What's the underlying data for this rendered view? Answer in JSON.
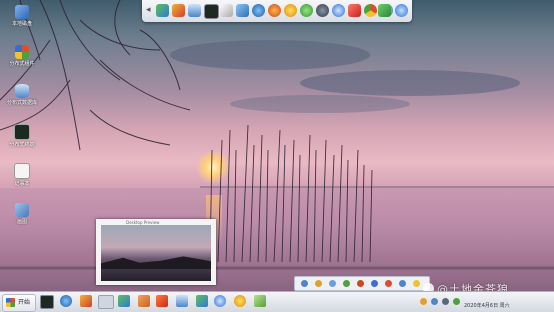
{
  "desktop": {
    "icons": [
      {
        "label": "本地磁盘",
        "icon": "computer-icon"
      },
      {
        "label": "分布式组件",
        "icon": "components-icon"
      },
      {
        "label": "分布式数据库",
        "icon": "database-icon"
      },
      {
        "label": "分布式终端",
        "icon": "terminal-icon"
      },
      {
        "label": "记事本",
        "icon": "notepad-icon"
      },
      {
        "label": "画图",
        "icon": "paint-icon"
      }
    ]
  },
  "quickbar": {
    "icons": [
      "users-icon",
      "tools-icon",
      "database-icon",
      "terminal-icon",
      "pen-icon",
      "network-icon",
      "globe-icon",
      "firefox-icon",
      "sun-icon",
      "green-orb-icon",
      "gear-icon",
      "safari-icon",
      "red-app-icon",
      "chrome-icon",
      "blue-globe-icon",
      "monitor-icon",
      "power-icon"
    ]
  },
  "preview": {
    "title": "Desktop Preview"
  },
  "taskbar": {
    "start_label": "开始",
    "apps": [
      "terminal-icon",
      "globe-icon",
      "tools-icon",
      "network-icon",
      "users-icon",
      "box-icon",
      "fire-icon",
      "database-icon",
      "users-icon",
      "safari-icon",
      "sun-icon",
      "pen-icon"
    ],
    "clock_time": "",
    "clock_date": "2020年4月6日 周六"
  },
  "watermark": "@土地金苍狼",
  "colors": {
    "accent": "#2f6fd6",
    "taskbar": "#e3e7ec"
  }
}
